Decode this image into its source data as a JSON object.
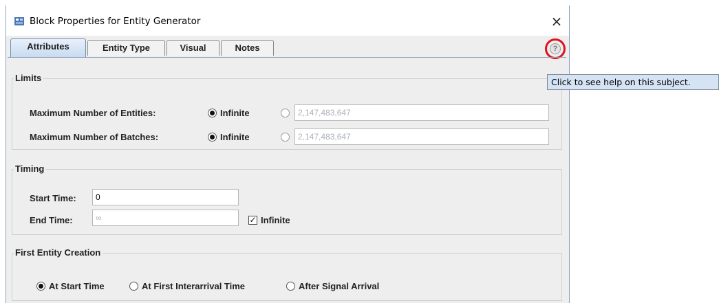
{
  "window": {
    "title": "Block Properties for Entity Generator",
    "close_glyph": "×"
  },
  "tabs": [
    {
      "label": "Attributes",
      "active": true
    },
    {
      "label": "Entity Type",
      "active": false
    },
    {
      "label": "Visual",
      "active": false
    },
    {
      "label": "Notes",
      "active": false
    }
  ],
  "help": {
    "icon": "help-icon",
    "glyph": "?",
    "highlight_color": "#e0121b",
    "tooltip": "Click to see help on this subject."
  },
  "limits": {
    "title": "Limits",
    "max_entities": {
      "label": "Maximum Number of Entities:",
      "option_infinite": "Infinite",
      "selected": "infinite",
      "value": "2,147,483,647"
    },
    "max_batches": {
      "label": "Maximum Number of Batches:",
      "option_infinite": "Infinite",
      "selected": "infinite",
      "value": "2,147,483,647"
    }
  },
  "timing": {
    "title": "Timing",
    "start_time": {
      "label": "Start Time:",
      "value": "0"
    },
    "end_time": {
      "label": "End Time:",
      "value": "∞"
    },
    "infinite_checkbox": {
      "label": "Infinite",
      "checked": true
    }
  },
  "first_entity_creation": {
    "title": "First Entity Creation",
    "options": [
      {
        "label": "At Start Time",
        "selected": true
      },
      {
        "label": "At First Interarrival Time",
        "selected": false
      },
      {
        "label": "After Signal Arrival",
        "selected": false
      }
    ]
  },
  "colors": {
    "window_bg": "#eeeeee",
    "tab_active_bg": "#c9dbf0",
    "tooltip_bg": "#d6e3f4"
  }
}
